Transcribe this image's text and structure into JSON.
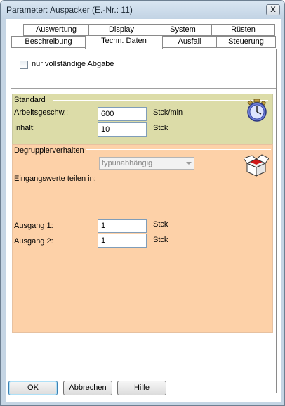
{
  "window": {
    "title": "Parameter: Auspacker (E.-Nr.: 11)",
    "close_label": "X"
  },
  "tabs": {
    "row1": [
      "Auswertung",
      "Display",
      "System",
      "Rüsten"
    ],
    "row2": [
      "Beschreibung",
      "Techn. Daten",
      "Ausfall",
      "Steuerung"
    ],
    "active": "Techn. Daten"
  },
  "options": {
    "nur_vollstaendige_abgabe": {
      "label": "nur vollständige Abgabe",
      "checked": false
    }
  },
  "standard": {
    "title": "Standard",
    "arbeitsgeschw": {
      "label": "Arbeitsgeschw.:",
      "value": "600",
      "unit": "Stck/min"
    },
    "inhalt": {
      "label": "Inhalt:",
      "value": "10",
      "unit": "Stck"
    }
  },
  "degruppier": {
    "title": "Degruppierverhalten",
    "mode": {
      "selected": "typunabhängig"
    },
    "eingangswerte_label": "Eingangswerte teilen in:",
    "ausgang1": {
      "label": "Ausgang 1:",
      "value": "1",
      "unit": "Stck"
    },
    "ausgang2": {
      "label": "Ausgang 2:",
      "value": "1",
      "unit": "Stck"
    }
  },
  "buttons": {
    "ok": "OK",
    "abbrechen": "Abbrechen",
    "hilfe": "Hilfe"
  },
  "colors": {
    "standard_bg": "#dcdca8",
    "degruppier_bg": "#fdd1a8"
  }
}
